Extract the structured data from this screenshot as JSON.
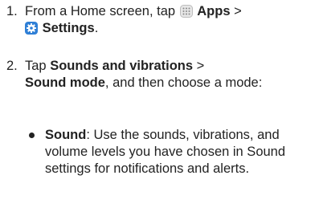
{
  "steps": [
    {
      "number": "1.",
      "text_before": "From a Home screen, tap",
      "apps_icon": "apps-grid-icon",
      "apps_label": "Apps",
      "separator": ">",
      "settings_icon": "settings-gear-icon",
      "settings_label": "Settings",
      "end": "."
    },
    {
      "number": "2.",
      "text_before": "Tap",
      "menu1": "Sounds and vibrations",
      "separator": ">",
      "menu2": "Sound mode",
      "text_after": ", and then choose a mode:"
    }
  ],
  "bullets": [
    {
      "term": "Sound",
      "description": ": Use the sounds, vibrations, and volume levels you have chosen in Sound settings for notifications and alerts."
    }
  ],
  "colors": {
    "text": "#222222",
    "settings_icon_bg": "#2f7fd6",
    "apps_icon_bg": "#e6e6e6"
  }
}
